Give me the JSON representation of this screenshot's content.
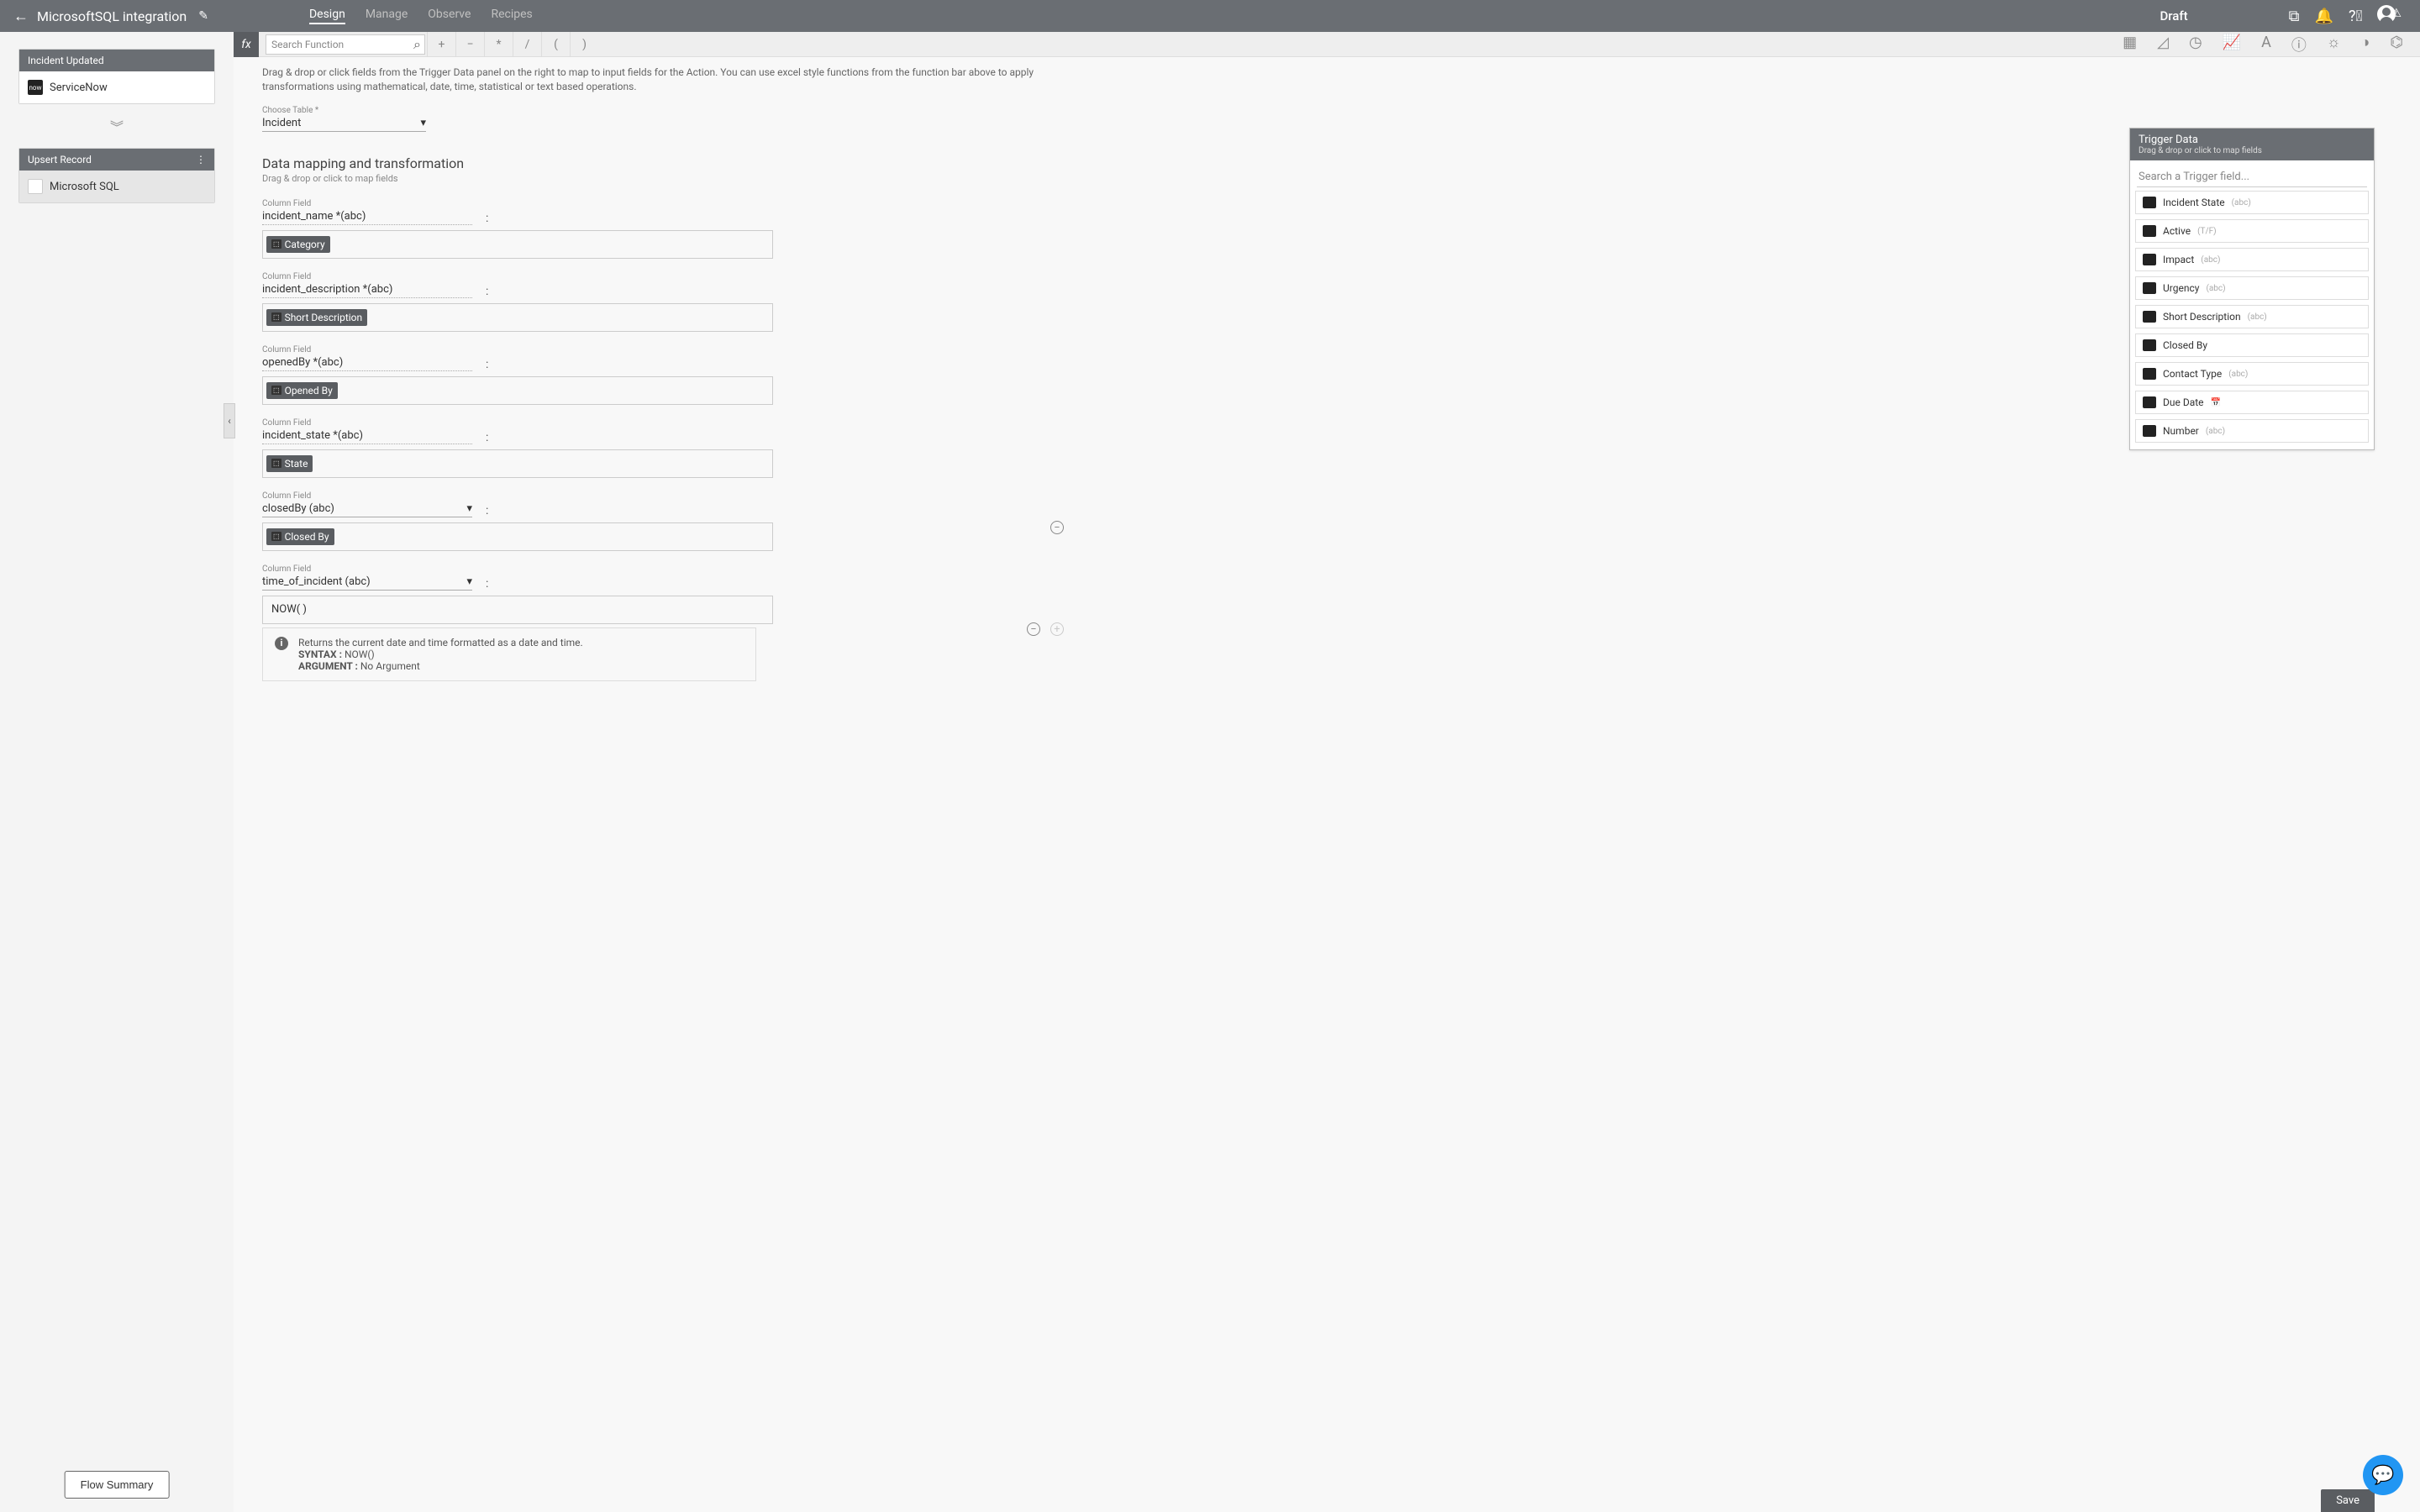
{
  "header": {
    "title": "MicrosoftSQL integration",
    "tabs": [
      "Design",
      "Manage",
      "Observe",
      "Recipes"
    ],
    "status": "Draft"
  },
  "sidebar": {
    "trigger": {
      "title": "Incident Updated",
      "app": "ServiceNow",
      "chip": "now"
    },
    "action": {
      "title": "Upsert Record",
      "app": "Microsoft SQL"
    },
    "summary_btn": "Flow Summary"
  },
  "fnbar": {
    "search_placeholder": "Search Function",
    "ops": [
      "+",
      "−",
      "*",
      "/",
      "(",
      ")"
    ]
  },
  "hint": "Drag & drop or click fields from the Trigger Data panel on the right to map to input fields for the Action. You can use excel style functions from the function bar above to apply transformations using mathematical, date, time, statistical or text based operations.",
  "table": {
    "label": "Choose Table *",
    "value": "Incident"
  },
  "section": {
    "title": "Data mapping and transformation",
    "sub": "Drag & drop or click to map fields"
  },
  "fields_label": "Column Field",
  "fields": [
    {
      "name": "incident_name *(abc)",
      "pill": "Category",
      "dropdown": false
    },
    {
      "name": "incident_description *(abc)",
      "pill": "Short Description",
      "dropdown": false
    },
    {
      "name": "openedBy *(abc)",
      "pill": "Opened By",
      "dropdown": false
    },
    {
      "name": "incident_state *(abc)",
      "pill": "State",
      "dropdown": false
    },
    {
      "name": "closedBy (abc)",
      "pill": "Closed By",
      "dropdown": true,
      "remove": true
    },
    {
      "name": "time_of_incident (abc)",
      "text": "NOW( )",
      "dropdown": true,
      "help": true,
      "remove": true,
      "add": true
    }
  ],
  "help": {
    "line1": "Returns the current date and time formatted as a date and time.",
    "syntax_l": "SYNTAX :",
    "syntax_v": "NOW()",
    "arg_l": "ARGUMENT :",
    "arg_v": "No Argument"
  },
  "trigger": {
    "title": "Trigger Data",
    "sub": "Drag & drop or click to map fields",
    "search": "Search a Trigger field...",
    "items": [
      {
        "name": "Incident State",
        "type": "(abc)"
      },
      {
        "name": "Active",
        "type": "(T/F)"
      },
      {
        "name": "Impact",
        "type": "(abc)"
      },
      {
        "name": "Urgency",
        "type": "(abc)"
      },
      {
        "name": "Short Description",
        "type": "(abc)"
      },
      {
        "name": "Closed By",
        "type": ""
      },
      {
        "name": "Contact Type",
        "type": "(abc)"
      },
      {
        "name": "Due Date",
        "type": "",
        "date": true
      },
      {
        "name": "Number",
        "type": "(abc)"
      }
    ]
  },
  "save": "Save"
}
